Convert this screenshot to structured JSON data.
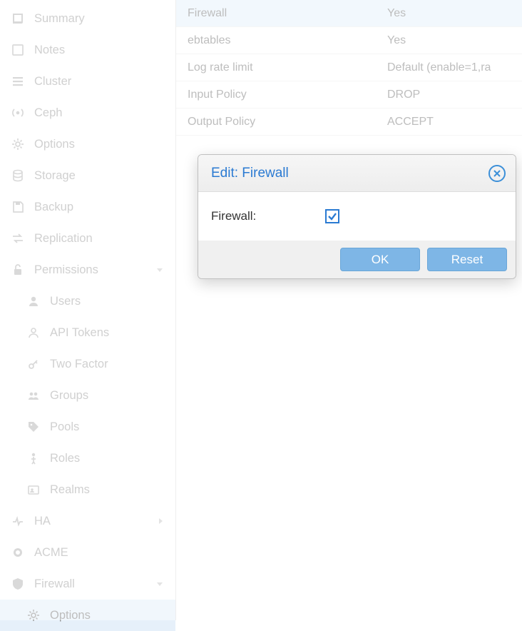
{
  "sidebar": {
    "items": [
      {
        "icon": "book",
        "label": "Summary"
      },
      {
        "icon": "note",
        "label": "Notes"
      },
      {
        "icon": "bars",
        "label": "Cluster"
      },
      {
        "icon": "broadcast",
        "label": "Ceph"
      },
      {
        "icon": "gear",
        "label": "Options"
      },
      {
        "icon": "db",
        "label": "Storage"
      },
      {
        "icon": "save",
        "label": "Backup"
      },
      {
        "icon": "exchange",
        "label": "Replication"
      },
      {
        "icon": "unlock",
        "label": "Permissions",
        "expandable": true
      },
      {
        "icon": "user",
        "label": "Users",
        "sub": true
      },
      {
        "icon": "userring",
        "label": "API Tokens",
        "sub": true
      },
      {
        "icon": "key",
        "label": "Two Factor",
        "sub": true
      },
      {
        "icon": "group",
        "label": "Groups",
        "sub": true
      },
      {
        "icon": "tags",
        "label": "Pools",
        "sub": true
      },
      {
        "icon": "person",
        "label": "Roles",
        "sub": true
      },
      {
        "icon": "idcard",
        "label": "Realms",
        "sub": true
      },
      {
        "icon": "heartbeat",
        "label": "HA",
        "expandable": true,
        "chevron": "right"
      },
      {
        "icon": "cert",
        "label": "ACME"
      },
      {
        "icon": "shield",
        "label": "Firewall",
        "expandable": true
      },
      {
        "icon": "gear",
        "label": "Options",
        "sub": true,
        "active": true
      }
    ]
  },
  "table": {
    "rows": [
      {
        "key": "Firewall",
        "val": "Yes",
        "highlighted": true
      },
      {
        "key": "ebtables",
        "val": "Yes"
      },
      {
        "key": "Log rate limit",
        "val": "Default (enable=1,ra"
      },
      {
        "key": "Input Policy",
        "val": "DROP"
      },
      {
        "key": "Output Policy",
        "val": "ACCEPT"
      }
    ]
  },
  "dialog": {
    "title": "Edit: Firewall",
    "field_label": "Firewall:",
    "checked": true,
    "ok_label": "OK",
    "reset_label": "Reset"
  }
}
